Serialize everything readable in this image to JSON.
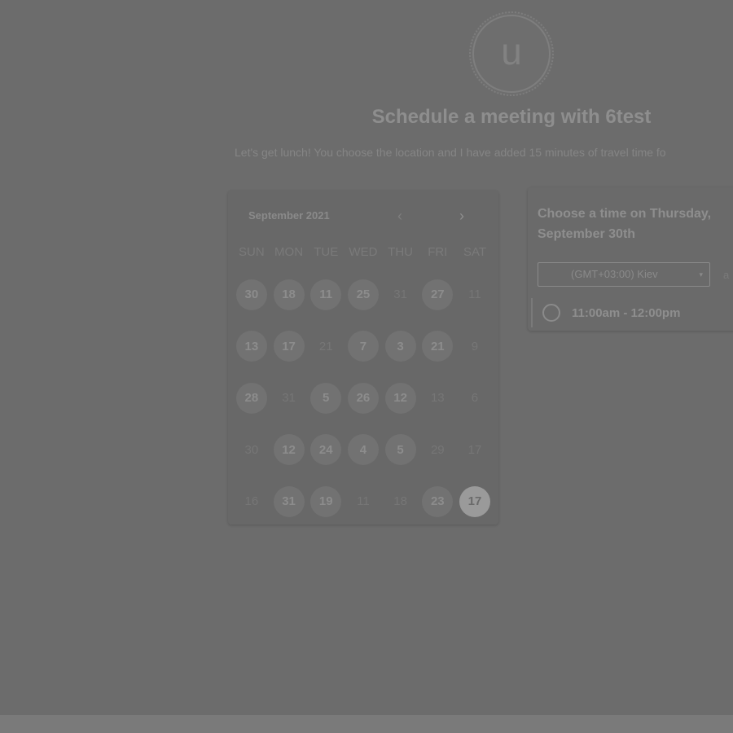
{
  "header": {
    "avatar_letter": "u",
    "title": "Schedule a meeting with 6test",
    "subtitle": "Let's get lunch! You choose the location and I have added 15 minutes of travel time fo"
  },
  "calendar": {
    "month_label": "September 2021",
    "prev_icon": "chevron-left-icon",
    "next_icon": "chevron-right-icon",
    "weekdays": [
      "SUN",
      "MON",
      "TUE",
      "WED",
      "THU",
      "FRI",
      "SAT"
    ],
    "days": [
      {
        "label": "30",
        "state": "avail"
      },
      {
        "label": "18",
        "state": "avail"
      },
      {
        "label": "11",
        "state": "avail"
      },
      {
        "label": "25",
        "state": "avail"
      },
      {
        "label": "31",
        "state": "dim"
      },
      {
        "label": "27",
        "state": "avail"
      },
      {
        "label": "11",
        "state": "dim"
      },
      {
        "label": "13",
        "state": "avail"
      },
      {
        "label": "17",
        "state": "avail"
      },
      {
        "label": "21",
        "state": "dim"
      },
      {
        "label": "7",
        "state": "avail"
      },
      {
        "label": "3",
        "state": "avail"
      },
      {
        "label": "21",
        "state": "avail"
      },
      {
        "label": "9",
        "state": "dim"
      },
      {
        "label": "28",
        "state": "avail"
      },
      {
        "label": "31",
        "state": "dim"
      },
      {
        "label": "5",
        "state": "avail"
      },
      {
        "label": "26",
        "state": "avail"
      },
      {
        "label": "12",
        "state": "avail"
      },
      {
        "label": "13",
        "state": "dim"
      },
      {
        "label": "6",
        "state": "dim"
      },
      {
        "label": "30",
        "state": "dim"
      },
      {
        "label": "12",
        "state": "avail"
      },
      {
        "label": "24",
        "state": "avail"
      },
      {
        "label": "4",
        "state": "avail"
      },
      {
        "label": "5",
        "state": "avail"
      },
      {
        "label": "29",
        "state": "dim"
      },
      {
        "label": "17",
        "state": "dim"
      },
      {
        "label": "16",
        "state": "dim"
      },
      {
        "label": "31",
        "state": "avail"
      },
      {
        "label": "19",
        "state": "avail"
      },
      {
        "label": "11",
        "state": "dim"
      },
      {
        "label": "18",
        "state": "dim"
      },
      {
        "label": "23",
        "state": "avail"
      },
      {
        "label": "17",
        "state": "selected"
      }
    ]
  },
  "time_panel": {
    "heading": "Choose a time on Thursday, September 30th",
    "timezone": "(GMT+03:00) Kiev",
    "timezone_arrow": "▾",
    "extra": "a",
    "slot_label": "11:00am - 12:00pm"
  },
  "colors": {
    "background": "#6c6c6c",
    "bottom_bar": "#7a7a7a",
    "selected_day": "#9a9a9a"
  }
}
